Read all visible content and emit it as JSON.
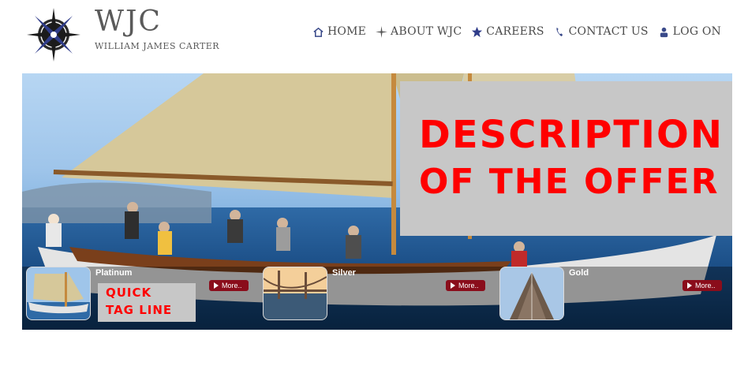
{
  "brand": {
    "name": "WJC",
    "subtitle": "WILLIAM JAMES CARTER"
  },
  "nav": [
    {
      "label": "HOME",
      "icon": "home-icon"
    },
    {
      "label": "ABOUT WJC",
      "icon": "compass-star-icon"
    },
    {
      "label": "CAREERS",
      "icon": "star-icon"
    },
    {
      "label": "CONTACT US",
      "icon": "phone-icon"
    },
    {
      "label": "LOG ON",
      "icon": "user-icon"
    }
  ],
  "hero": {
    "offer_line1": "DESCRIPTION",
    "offer_line2": "OF THE OFFER"
  },
  "cards": [
    {
      "title": "Platinum",
      "more": "More..",
      "tagline_line1": "QUICK",
      "tagline_line2": "TAG LINE"
    },
    {
      "title": "Silver",
      "more": "More.."
    },
    {
      "title": "Gold",
      "more": "More.."
    }
  ],
  "colors": {
    "offer_text": "#ff0000",
    "offer_bg": "#c7c7c7",
    "more_button_bg": "#8a0d1b",
    "nav_icon": "#3a4a8a"
  }
}
